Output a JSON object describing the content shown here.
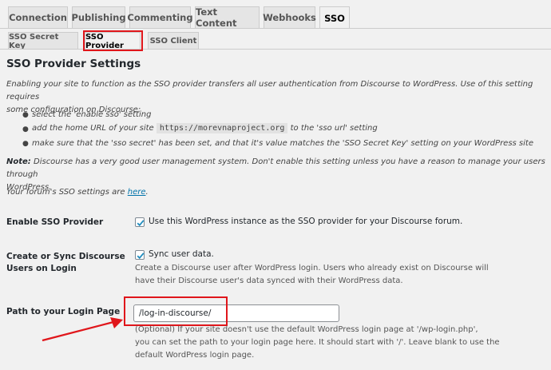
{
  "tabs": [
    {
      "label": "Connection"
    },
    {
      "label": "Publishing"
    },
    {
      "label": "Commenting"
    },
    {
      "label": "Text Content"
    },
    {
      "label": "Webhooks"
    },
    {
      "label": "SSO"
    }
  ],
  "subtabs": [
    {
      "label": "SSO Secret Key"
    },
    {
      "label": "SSO Provider"
    },
    {
      "label": "SSO Client"
    }
  ],
  "section": {
    "title": "SSO Provider Settings",
    "intro_line1": "Enabling your site to function as the SSO provider transfers all user authentication from Discourse to WordPress. Use of this setting requires",
    "intro_line2": "some configuration on Discourse:",
    "bullet1": "select the 'enable sso' setting",
    "bullet2_pre": "add the home URL of your site",
    "bullet2_code": "https://morevnaproject.org",
    "bullet2_post": "to the 'sso url' setting",
    "bullet3": "make sure that the 'sso secret' has been set, and that it's value matches the 'SSO Secret Key' setting on your WordPress site",
    "note_label": "Note:",
    "note_line1": "Discourse has a very good user management system. Don't enable this setting unless you have a reason to manage your users through",
    "note_line2": "WordPress.",
    "forum_pre": "Your forum's SSO settings are",
    "forum_link": "here",
    "forum_post": "."
  },
  "settings": {
    "enable": {
      "label": "Enable SSO Provider",
      "checkbox_text": "Use this WordPress instance as the SSO provider for your Discourse forum.",
      "checked": true
    },
    "sync": {
      "label_line1": "Create or Sync Discourse",
      "label_line2": "Users on Login",
      "checkbox_text": "Sync user data.",
      "checked": true,
      "desc_line1": "Create a Discourse user after WordPress login. Users who already exist on Discourse will",
      "desc_line2": "have their Discourse user's data synced with their WordPress data."
    },
    "login_path": {
      "label": "Path to your Login Page",
      "value": "/log-in-discourse/",
      "desc_line1": "(Optional) If your site doesn't use the default WordPress login page at '/wp-login.php',",
      "desc_line2": "you can set the path to your login page here. It should start with '/'. Leave blank to use the",
      "desc_line3": "default WordPress login page."
    }
  },
  "annotation_color": "#e0161b"
}
